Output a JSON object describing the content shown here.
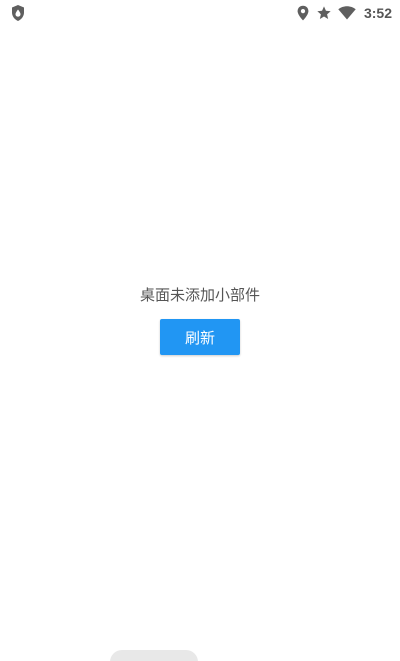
{
  "status_bar": {
    "time": "3:52",
    "left_icon": "shield-drop-icon",
    "right_icons": [
      "location-icon",
      "star-icon",
      "wifi-icon"
    ]
  },
  "main": {
    "empty_message": "桌面未添加小部件",
    "refresh_label": "刷新"
  },
  "colors": {
    "accent": "#2196f3",
    "text": "#555555",
    "background": "#ffffff"
  }
}
